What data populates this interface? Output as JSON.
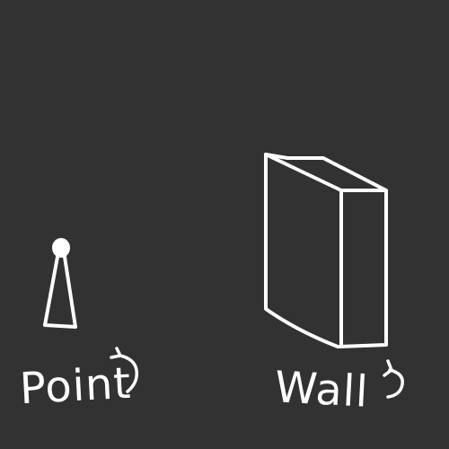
{
  "labels": {
    "point": "Point",
    "wall": "Wall"
  },
  "colors": {
    "background": "#323232",
    "stroke": "#ffffff"
  },
  "icons": {
    "point": "point-light-icon",
    "wall": "wall-box-icon",
    "point_arrow": "curved-arrow-icon",
    "wall_arrow": "curved-arrow-icon"
  }
}
